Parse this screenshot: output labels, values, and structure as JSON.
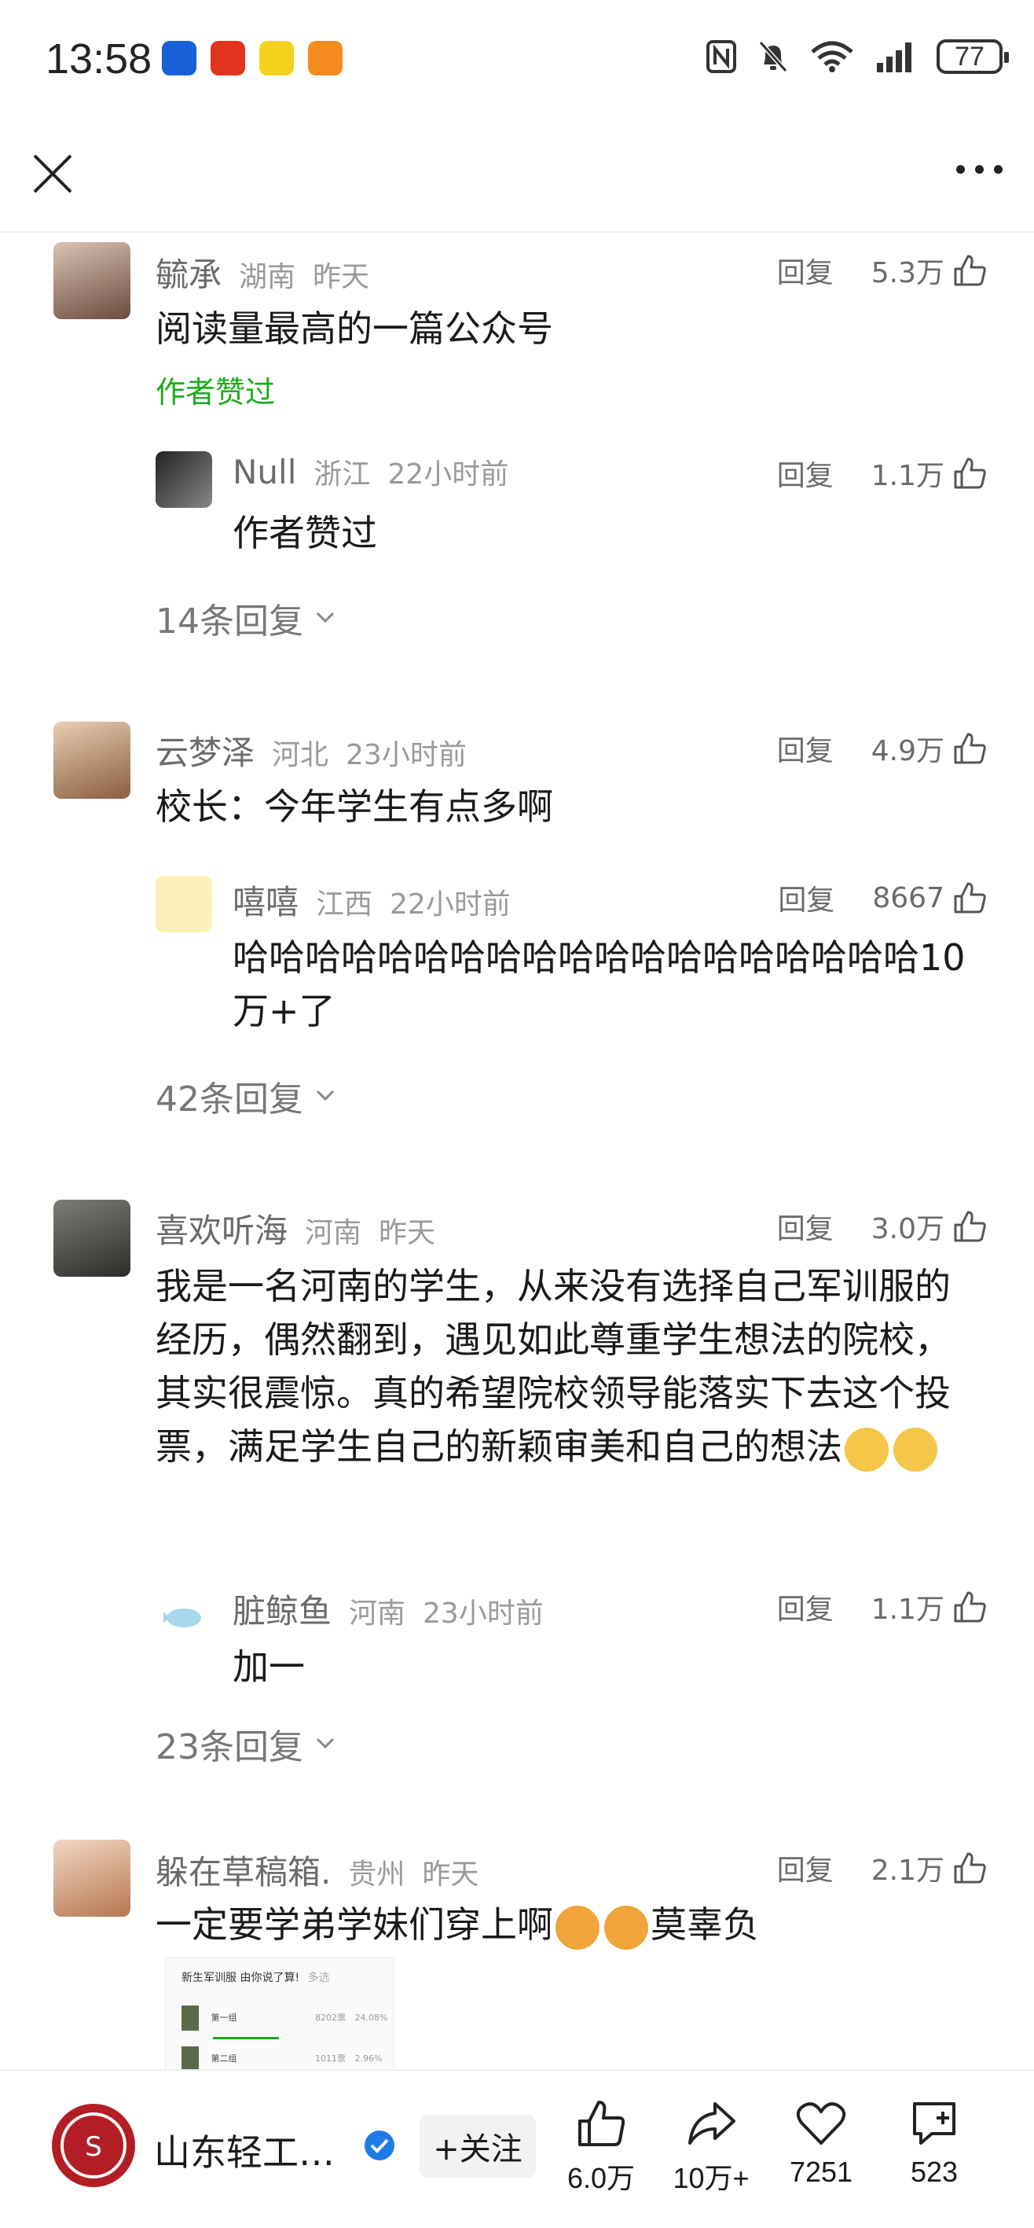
{
  "status": {
    "time": "13:58",
    "battery": "77"
  },
  "comments": [
    {
      "user": "毓承",
      "location": "湖南",
      "time": "昨天",
      "reply_label": "回复",
      "likes": "5.3万",
      "text": "阅读量最高的一篇公众号",
      "author_liked": "作者赞过",
      "reply": {
        "user": "Null",
        "location": "浙江",
        "time": "22小时前",
        "reply_label": "回复",
        "likes": "1.1万",
        "text": "作者赞过"
      },
      "more": "14条回复"
    },
    {
      "user": "云梦泽",
      "location": "河北",
      "time": "23小时前",
      "reply_label": "回复",
      "likes": "4.9万",
      "text": "校长：今年学生有点多啊",
      "reply": {
        "user": "嘻嘻",
        "location": "江西",
        "time": "22小时前",
        "reply_label": "回复",
        "likes": "8667",
        "text": "哈哈哈哈哈哈哈哈哈哈哈哈哈哈哈哈哈哈哈10万+了"
      },
      "more": "42条回复"
    },
    {
      "user": "喜欢听海",
      "location": "河南",
      "time": "昨天",
      "reply_label": "回复",
      "likes": "3.0万",
      "text": "我是一名河南的学生，从来没有选择自己军训服的经历，偶然翻到，遇见如此尊重学生想法的院校，其实很震惊。真的希望院校领导能落实下去这个投票，满足学生自己的新颖审美和自己的想法",
      "reply": {
        "user": "脏鲸鱼",
        "location": "河南",
        "time": "23小时前",
        "reply_label": "回复",
        "likes": "1.1万",
        "text": "加一"
      },
      "more": "23条回复"
    },
    {
      "user": "躲在草稿箱.",
      "location": "贵州",
      "time": "昨天",
      "reply_label": "回复",
      "likes": "2.1万",
      "text_before": "一定要学弟学妹们穿上啊",
      "text_after": "莫辜负"
    }
  ],
  "embed": {
    "title": "新生军训服 由你说了算!",
    "tag": "多选",
    "rows": [
      {
        "label": "第一组",
        "votes": "8202票",
        "pct": "24.08%"
      },
      {
        "label": "第二组",
        "votes": "1011票",
        "pct": "2.96%"
      }
    ]
  },
  "bottom": {
    "account": "山东轻工…",
    "follow": "+关注",
    "like_count": "6.0万",
    "share_count": "10万+",
    "fav_count": "7251",
    "comment_count": "523"
  },
  "colors": {
    "green": "#1aad19",
    "verify": "#1e7ae6",
    "logo": "#b31e25"
  }
}
